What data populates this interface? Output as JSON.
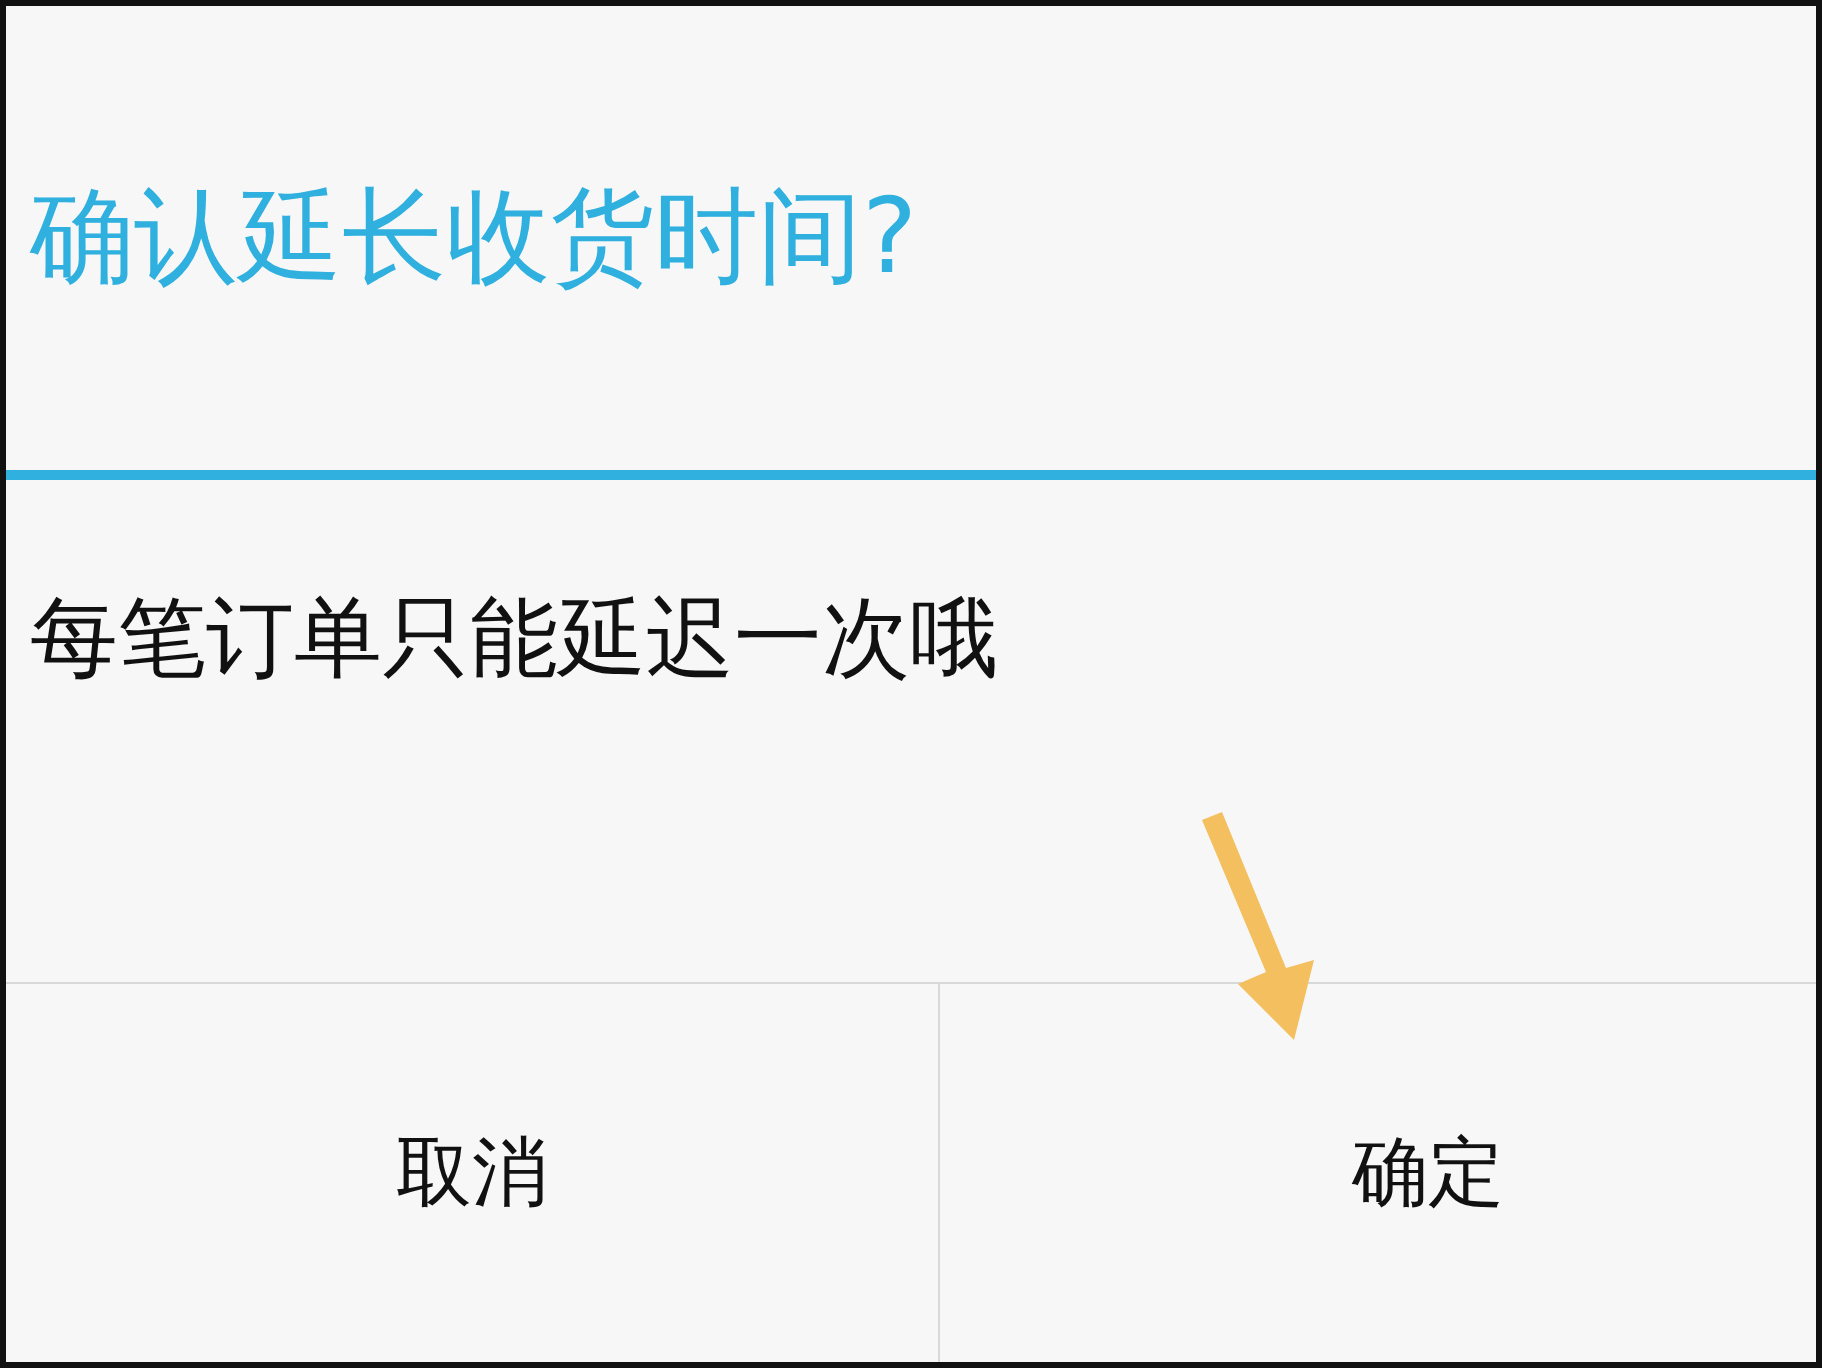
{
  "dialog": {
    "title": "确认延长收货时间?",
    "message": "每笔订单只能延迟一次哦",
    "buttons": [
      {
        "label": "取消",
        "kind": "cancel"
      },
      {
        "label": "确定",
        "kind": "confirm"
      }
    ]
  }
}
